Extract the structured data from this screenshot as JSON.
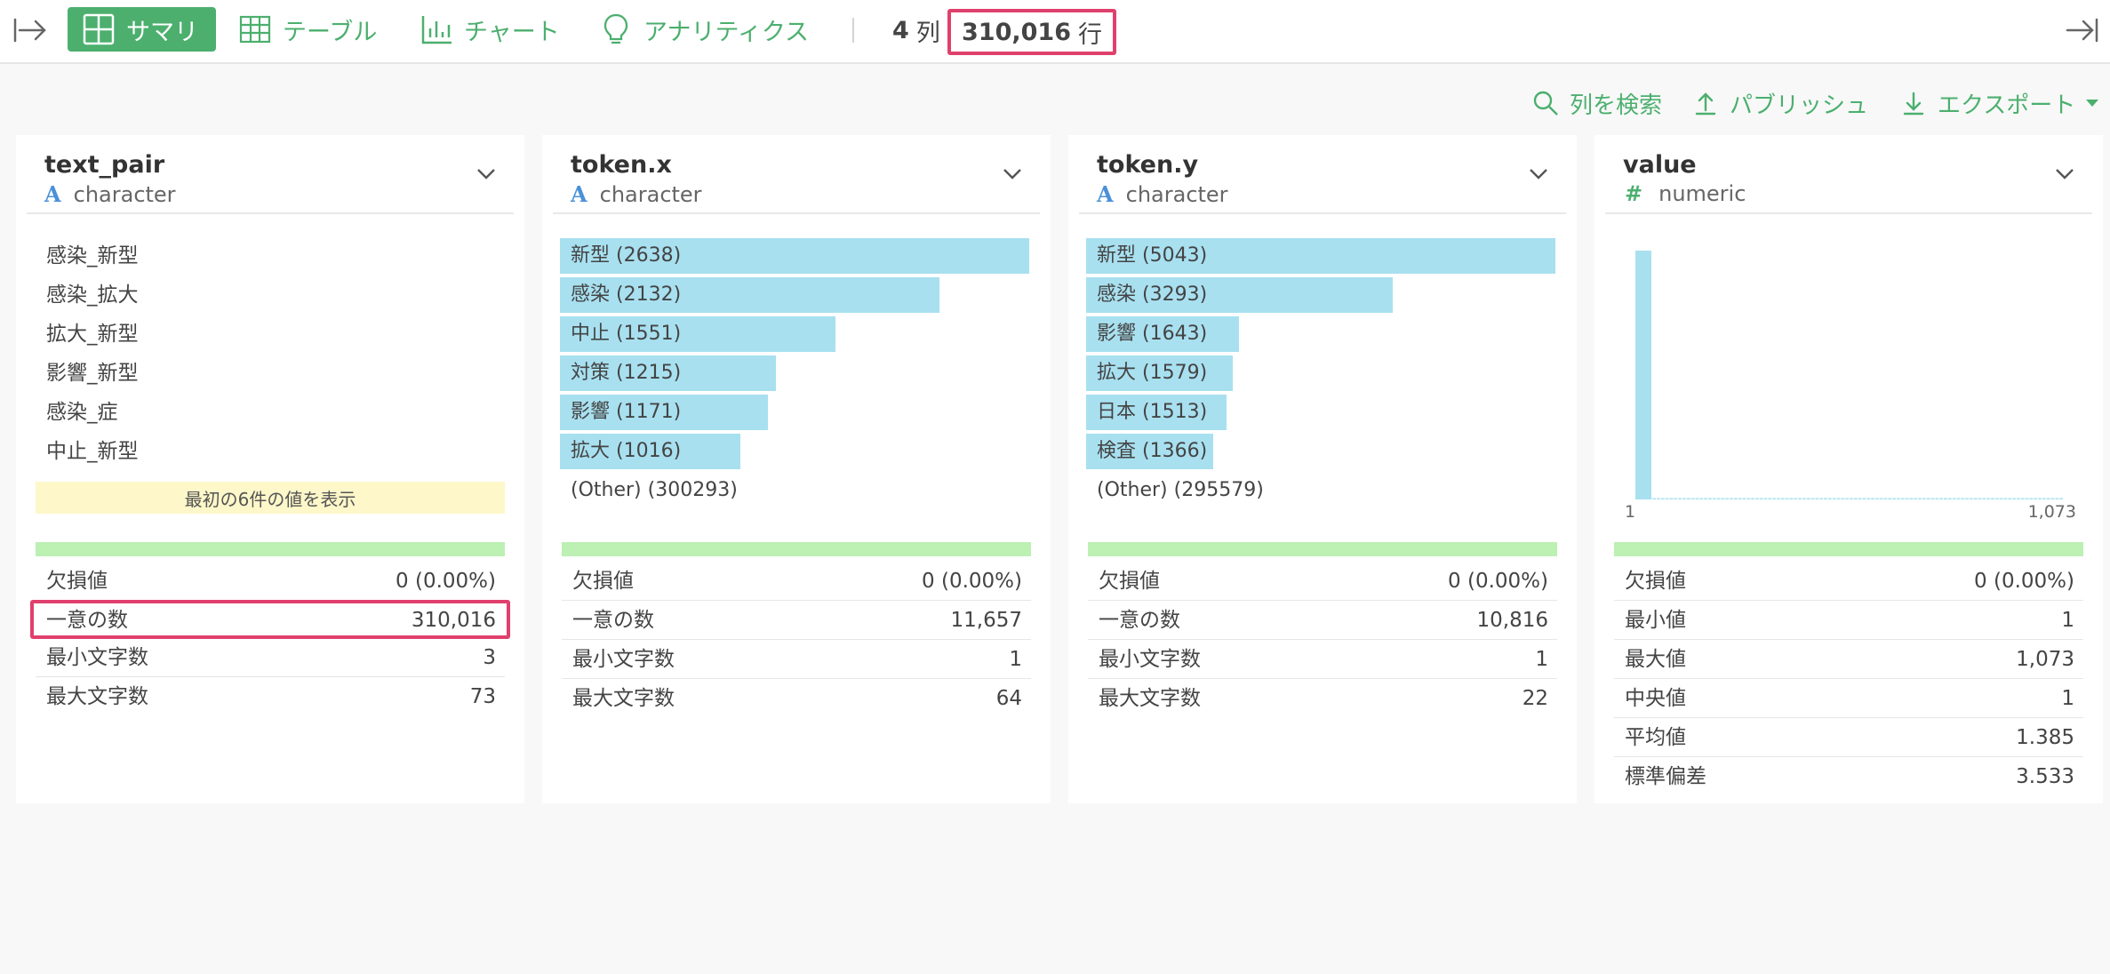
{
  "toolbar": {
    "tabs": [
      {
        "label": "サマリ",
        "icon": "summary-grid-icon",
        "active": true
      },
      {
        "label": "テーブル",
        "icon": "table-icon",
        "active": false
      },
      {
        "label": "チャート",
        "icon": "bar-chart-icon",
        "active": false
      },
      {
        "label": "アナリティクス",
        "icon": "lightbulb-icon",
        "active": false
      }
    ],
    "columns_count": "4",
    "columns_unit": "列",
    "rows_count": "310,016",
    "rows_unit": "行"
  },
  "actions": {
    "search_label": "列を検索",
    "publish_label": "パブリッシュ",
    "export_label": "エクスポート"
  },
  "cards": [
    {
      "name": "text_pair",
      "type": "character",
      "type_icon": "A",
      "top_values": [
        "感染_新型",
        "感染_拡大",
        "拡大_新型",
        "影響_新型",
        "感染_症",
        "中止_新型"
      ],
      "note": "最初の6件の値を表示",
      "stats": [
        {
          "label": "欠損値",
          "value": "0 (0.00%)"
        },
        {
          "label": "一意の数",
          "value": "310,016",
          "highlight": true
        },
        {
          "label": "最小文字数",
          "value": "3"
        },
        {
          "label": "最大文字数",
          "value": "73"
        }
      ]
    },
    {
      "name": "token.x",
      "type": "character",
      "type_icon": "A",
      "bars": [
        {
          "label": "新型 (2638)",
          "value": 2638
        },
        {
          "label": "感染 (2132)",
          "value": 2132
        },
        {
          "label": "中止 (1551)",
          "value": 1551
        },
        {
          "label": "対策 (1215)",
          "value": 1215
        },
        {
          "label": "影響 (1171)",
          "value": 1171
        },
        {
          "label": "拡大 (1016)",
          "value": 1016
        }
      ],
      "other": "(Other) (300293)",
      "stats": [
        {
          "label": "欠損値",
          "value": "0 (0.00%)"
        },
        {
          "label": "一意の数",
          "value": "11,657"
        },
        {
          "label": "最小文字数",
          "value": "1"
        },
        {
          "label": "最大文字数",
          "value": "64"
        }
      ]
    },
    {
      "name": "token.y",
      "type": "character",
      "type_icon": "A",
      "bars": [
        {
          "label": "新型 (5043)",
          "value": 5043
        },
        {
          "label": "感染 (3293)",
          "value": 3293
        },
        {
          "label": "影響 (1643)",
          "value": 1643
        },
        {
          "label": "拡大 (1579)",
          "value": 1579
        },
        {
          "label": "日本 (1513)",
          "value": 1513
        },
        {
          "label": "検査 (1366)",
          "value": 1366
        }
      ],
      "other": "(Other) (295579)",
      "stats": [
        {
          "label": "欠損値",
          "value": "0 (0.00%)"
        },
        {
          "label": "一意の数",
          "value": "10,816"
        },
        {
          "label": "最小文字数",
          "value": "1"
        },
        {
          "label": "最大文字数",
          "value": "22"
        }
      ]
    },
    {
      "name": "value",
      "type": "numeric",
      "type_icon": "#",
      "histogram": {
        "x_min_label": "1",
        "x_max_label": "1,073",
        "bins": [
          100,
          0.4,
          0.3,
          0.3,
          0.3,
          0.3,
          0.3,
          0.3,
          0.3,
          0.3,
          0.3,
          0.3,
          0.3,
          0.3,
          0.3,
          0.3,
          0.3,
          0.3,
          0.3,
          0.3,
          0.3,
          0.3,
          0.3,
          0.3,
          0.3,
          0.3,
          0.3,
          0.3,
          0.3,
          0.3,
          0.3,
          0.3,
          0.3,
          0.3,
          0.3,
          0.3,
          0.3,
          0.3,
          0.3,
          0.3,
          0.3,
          0.3,
          0.3,
          0.3,
          0.3,
          0.3,
          0.3,
          0.3,
          0.3,
          0.3,
          0.3,
          0.3,
          0.3,
          0.3,
          0.3,
          0.3,
          0.3,
          0.3,
          0.3,
          0.3,
          0.3,
          0.3,
          0.3,
          0.3,
          0.3,
          0.3,
          0.3,
          0.3,
          0.3,
          0.3,
          0.3,
          0.3,
          0.3,
          0.3,
          0.3,
          0.3,
          0.3,
          0.3,
          0.3,
          0.3,
          0.3,
          0.3,
          0.3,
          0.3,
          0.3,
          0.3,
          0.3,
          0.3,
          0.3,
          0.3,
          0.3,
          0.3,
          0.3,
          0.3,
          0.3,
          0.3,
          0.3,
          0.3,
          0.3,
          0.3
        ]
      },
      "stats": [
        {
          "label": "欠損値",
          "value": "0 (0.00%)"
        },
        {
          "label": "最小値",
          "value": "1"
        },
        {
          "label": "最大値",
          "value": "1,073"
        },
        {
          "label": "中央値",
          "value": "1"
        },
        {
          "label": "平均値",
          "value": "1.385"
        },
        {
          "label": "標準偏差",
          "value": "3.533"
        }
      ]
    }
  ],
  "colors": {
    "accent": "#4caf6e",
    "highlight": "#e0406d",
    "bar": "#a8e0f0",
    "stat_bar": "#bdf0b3",
    "note_bg": "#fdf7c9"
  }
}
